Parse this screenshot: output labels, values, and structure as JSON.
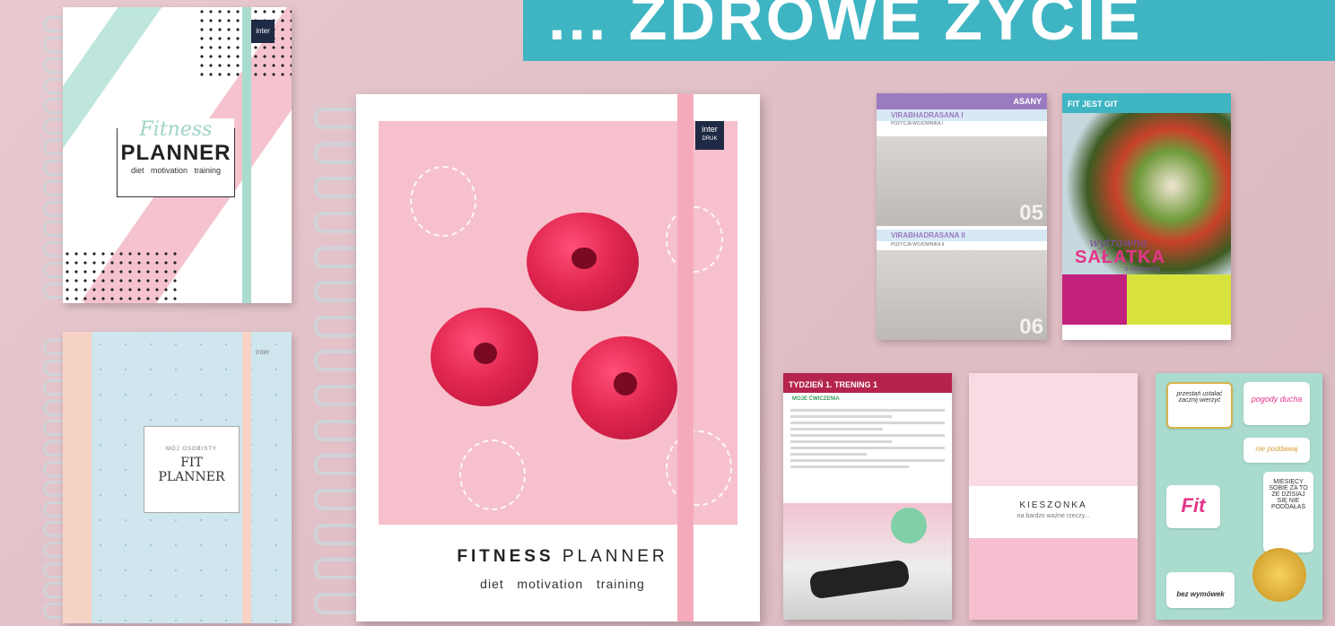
{
  "banner": {
    "text": "... ZDROWE ŻYCIE"
  },
  "planner_fitness_small": {
    "brand": "inter",
    "script_title": "Fitness",
    "title": "PLANNER",
    "subtitle": "diet   motivation   training"
  },
  "planner_fit_small": {
    "brand": "inter",
    "small_text": "MÓJ OSOBISTY",
    "title_line1": "FIT",
    "title_line2": "PLANNER"
  },
  "planner_big": {
    "brand_line1": "inter",
    "brand_line2": "DRUK",
    "title_word1": "FITNESS",
    "title_word2": "PLANNER",
    "subtitle": "diet   motivation   training"
  },
  "insert_asany": {
    "header": "ASANY",
    "pose1": "VIRABHADRASANA I",
    "pose1_sub": "POZYCJA WOJOWNIKA I",
    "pose1_num": "05",
    "pose2": "VIRABHADRASANA II",
    "pose2_sub": "POZYCJA WOJOWNIKA II",
    "pose2_num": "06"
  },
  "insert_salad": {
    "header": "FIT JEST GIT",
    "script": "wytrawna",
    "title": "SAŁATKA",
    "sub": "z mozzarellą"
  },
  "insert_training": {
    "header": "TYDZIEŃ 1. TRENING 1",
    "section": "MOJE ĆWICZENIA"
  },
  "insert_pocket": {
    "title": "KIESZONKA",
    "subtitle": "na bardzo ważne rzeczy..."
  },
  "stickers": {
    "s1": "przestań ustalać zacznij wierzyć",
    "s2": "pogody ducha",
    "s3": "nie poddawaj",
    "s4": "Fit",
    "s5": "MIESIĘCY SOBIE ZA TO ZE DZISIAJ SIĘ NIE PODDAŁAŚ",
    "s6": "bez wymówek"
  },
  "colors": {
    "banner": "#3fb5c3",
    "background": "#e2c1c8",
    "pink": "#f6c1cd",
    "raspberry": "#e2274f",
    "purple": "#9b7bbf",
    "training_red": "#b5244d",
    "mint": "#a9dccf"
  }
}
